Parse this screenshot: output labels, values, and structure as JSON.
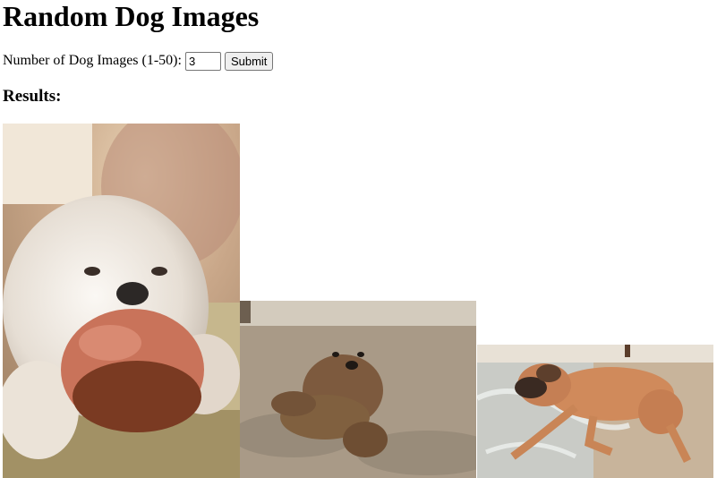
{
  "page": {
    "title": "Random Dog Images"
  },
  "form": {
    "label": "Number of Dog Images (1-50):",
    "count_value": "3",
    "submit_label": "Submit"
  },
  "results": {
    "heading": "Results:",
    "images": [
      {
        "name": "dog-image-1",
        "alt": "White shih tzu chewing a toy"
      },
      {
        "name": "dog-image-2",
        "alt": "Curly-haired terrier lying on dry grass"
      },
      {
        "name": "dog-image-3",
        "alt": "Large mastiff lying on a tiled floor"
      }
    ]
  }
}
